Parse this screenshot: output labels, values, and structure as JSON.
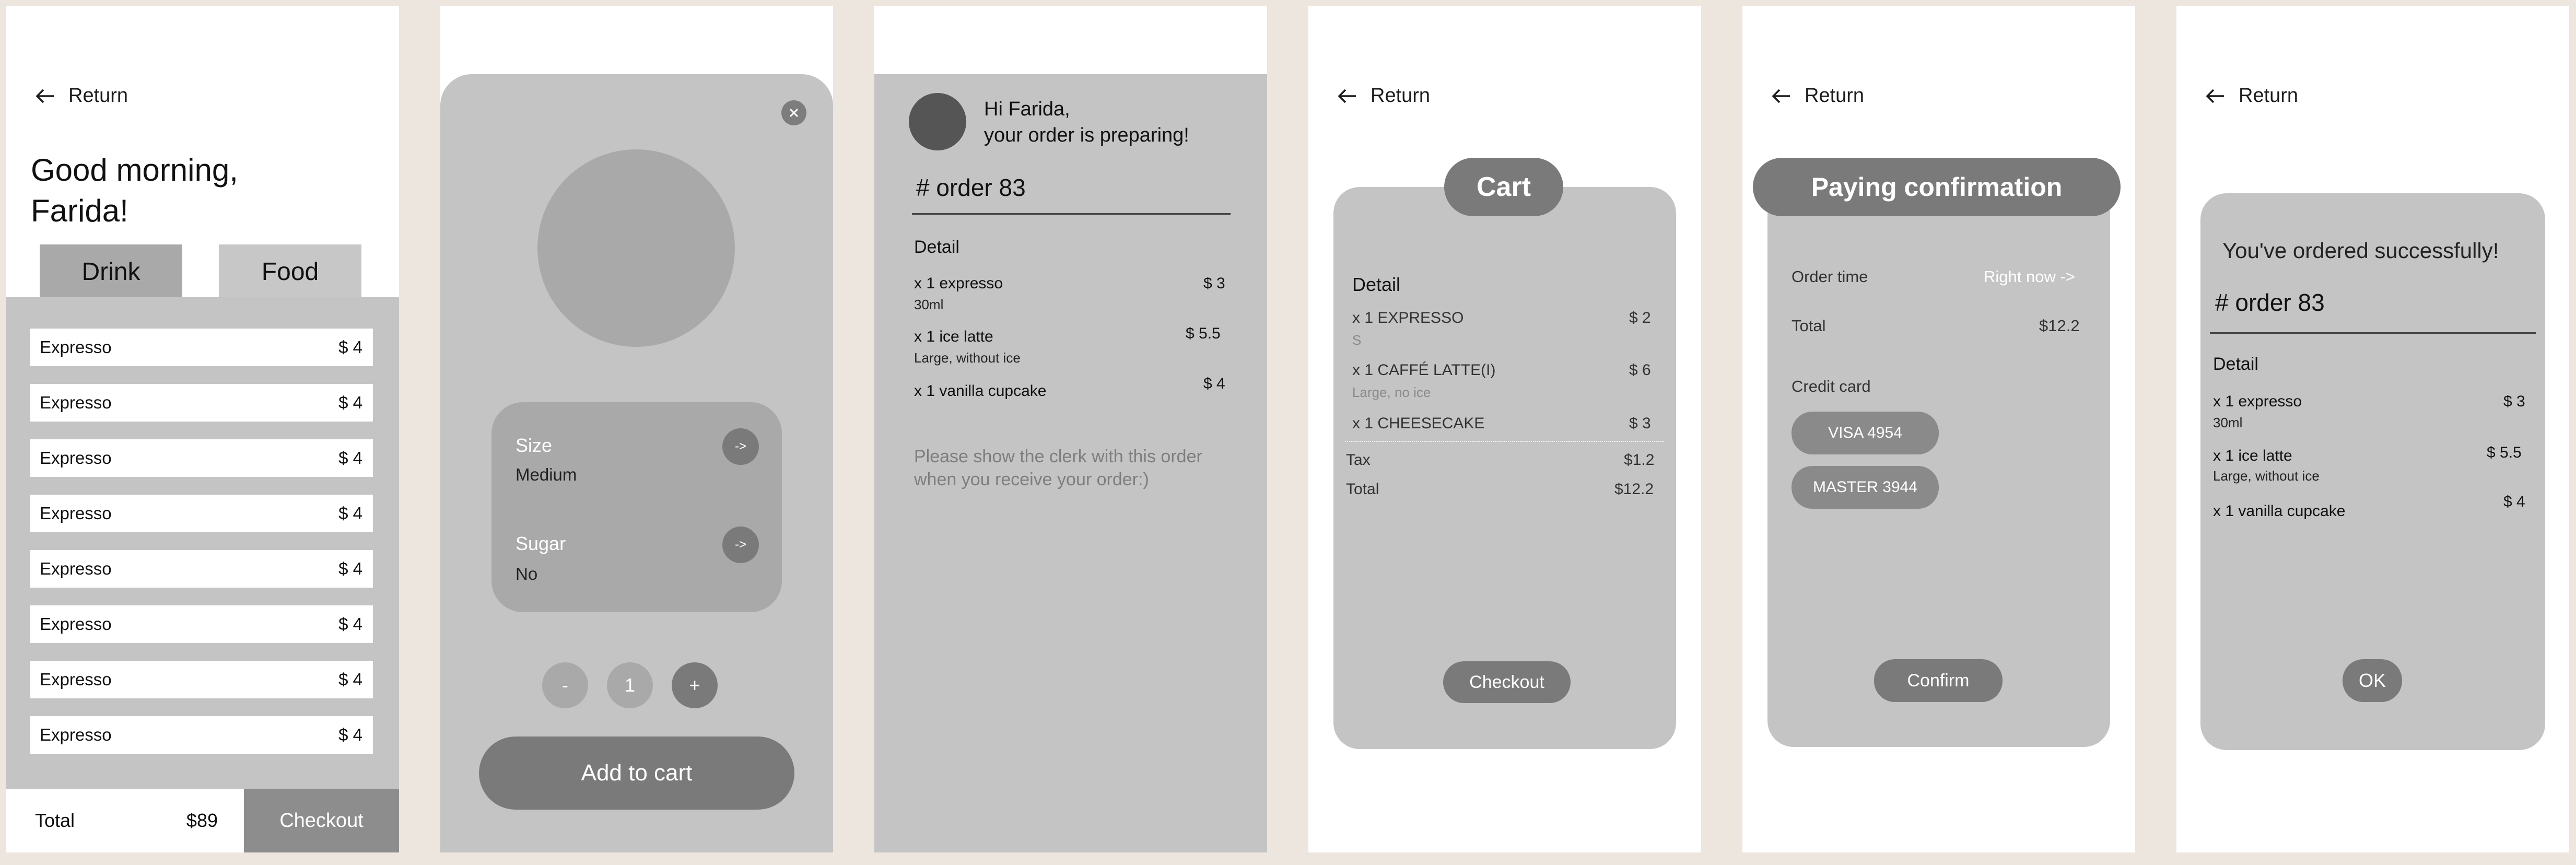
{
  "screen1": {
    "return_label": "Return",
    "greeting": "Good morning,\nFarida!",
    "tabs": [
      {
        "label": "Drink"
      },
      {
        "label": "Food"
      }
    ],
    "items": [
      {
        "name": "Expresso",
        "price": "$ 4"
      },
      {
        "name": "Expresso",
        "price": "$ 4"
      },
      {
        "name": "Expresso",
        "price": "$ 4"
      },
      {
        "name": "Expresso",
        "price": "$ 4"
      },
      {
        "name": "Expresso",
        "price": "$ 4"
      },
      {
        "name": "Expresso",
        "price": "$ 4"
      },
      {
        "name": "Expresso",
        "price": "$ 4"
      },
      {
        "name": "Expresso",
        "price": "$ 4"
      }
    ],
    "total_label": "Total",
    "total_value": "$89",
    "checkout_label": "Checkout"
  },
  "screen2": {
    "size_label": "Size",
    "size_value": "Medium",
    "sugar_label": "Sugar",
    "sugar_value": "No",
    "arrow_label": "->",
    "minus": "-",
    "quantity": "1",
    "plus": "+",
    "add_label": "Add to cart"
  },
  "screen3": {
    "greeting_line1": "Hi Farida,",
    "greeting_line2": "your order is preparing!",
    "order_title": "# order 83",
    "detail_label": "Detail",
    "items": [
      {
        "name": "x 1 expresso",
        "note": "30ml",
        "price": "$ 3"
      },
      {
        "name": "x 1 ice latte",
        "note": "Large, without ice",
        "price": "$ 5.5"
      },
      {
        "name": "x 1  vanilla cupcake",
        "note": "",
        "price": "$ 4"
      }
    ],
    "message": "Please show the clerk with this order\nwhen you receive your order:)"
  },
  "screen4": {
    "return_label": "Return",
    "title": "Cart",
    "detail_label": "Detail",
    "items": [
      {
        "name": "x 1 EXPRESSO",
        "note": "S",
        "price": "$ 2"
      },
      {
        "name": "x 1 CAFFÉ LATTE(I)",
        "note": "Large, no ice",
        "price": "$ 6"
      },
      {
        "name": "x 1  CHEESECAKE",
        "note": "",
        "price": "$ 3"
      }
    ],
    "tax_label": "Tax",
    "tax_value": "$1.2",
    "total_label": "Total",
    "total_value": "$12.2",
    "checkout_label": "Checkout"
  },
  "screen5": {
    "return_label": "Return",
    "title": "Paying confirmation",
    "order_time_label": "Order time",
    "order_time_value": "Right now ->",
    "total_label": "Total",
    "total_value": "$12.2",
    "credit_card_label": "Credit card",
    "cards": [
      {
        "label": "VISA 4954"
      },
      {
        "label": "MASTER 3944"
      }
    ],
    "confirm_label": "Confirm"
  },
  "screen6": {
    "return_label": "Return",
    "success": "You've ordered successfully!",
    "order_title": "# order 83",
    "detail_label": "Detail",
    "items": [
      {
        "name": "x 1 expresso",
        "note": "30ml",
        "price": "$ 3"
      },
      {
        "name": "x 1 ice latte",
        "note": "Large, without ice",
        "price": "$ 5.5"
      },
      {
        "name": "x 1  vanilla cupcake",
        "note": "",
        "price": "$ 4"
      }
    ],
    "ok_label": "OK"
  },
  "colors": {
    "backdrop": "#ece6de",
    "card": "#c4c4c4",
    "dark_button": "#7a7a7a",
    "tab_selected": "#a9a9a9"
  }
}
